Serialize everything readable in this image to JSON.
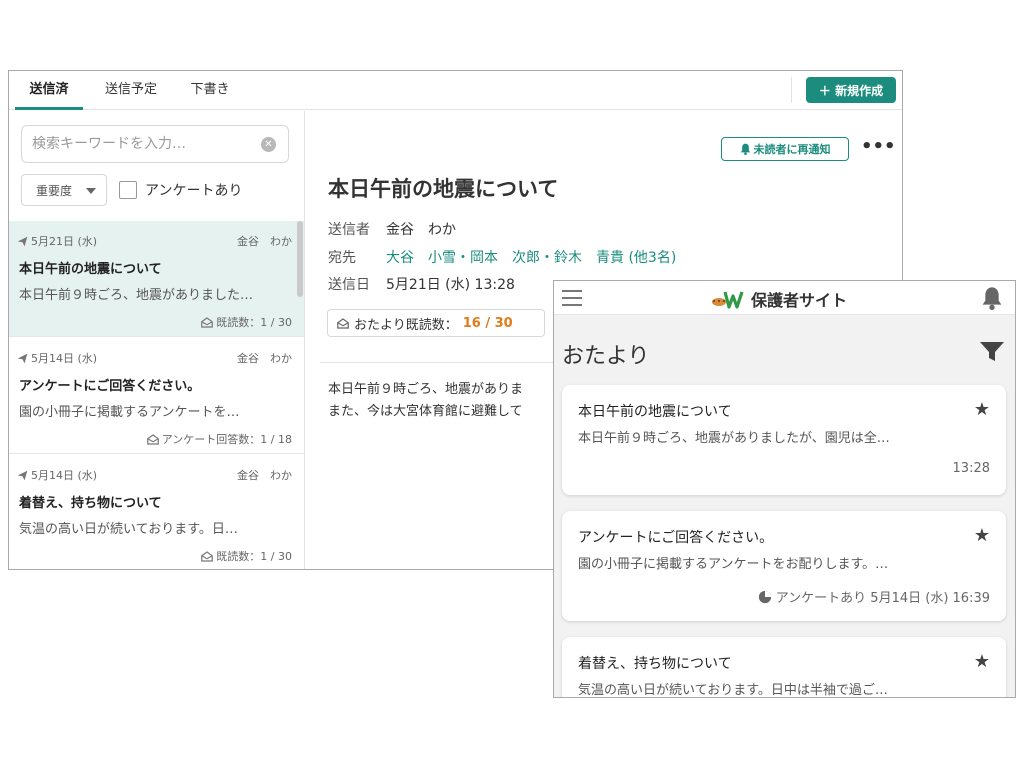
{
  "admin": {
    "tabs": [
      {
        "label": "送信済",
        "active": true
      },
      {
        "label": "送信予定",
        "active": false
      },
      {
        "label": "下書き",
        "active": false
      }
    ],
    "new_button": "＋ 新規作成",
    "search_placeholder": "検索キーワードを入力…",
    "priority_label": "重要度",
    "survey_filter_label": "アンケートあり",
    "messages": [
      {
        "date": "5月21日 (水)",
        "sender": "金谷　わか",
        "title": "本日午前の地震について",
        "preview": "本日午前９時ごろ、地震がありました…",
        "stat_icon": "open-envelope-icon",
        "stat": "既読数：1 / 30",
        "selected": true
      },
      {
        "date": "5月14日 (水)",
        "sender": "金谷　わか",
        "title": "アンケートにご回答ください。",
        "preview": "園の小冊子に掲載するアンケートを…",
        "stat_icon": "open-envelope-icon",
        "stat": "アンケート回答数：1 / 18",
        "selected": false
      },
      {
        "date": "5月14日 (水)",
        "sender": "金谷　わか",
        "title": "着替え、持ち物について",
        "preview": "気温の高い日が続いております。日…",
        "stat_icon": "open-envelope-icon",
        "stat": "既読数：1 / 30",
        "selected": false
      }
    ],
    "detail": {
      "renotify_label": "未読者に再通知",
      "more_label": "•••",
      "title": "本日午前の地震について",
      "from_label": "送信者",
      "from_value": "金谷　わか",
      "to_label": "宛先",
      "recipients": [
        "大谷",
        "小雪・岡本",
        "次郎・鈴木",
        "青貴 (他3名)"
      ],
      "date_label": "送信日",
      "date_value": "5月21日 (水) 13:28",
      "read_label": "おたより既読数：",
      "read_value": "16 / 30",
      "body_lines": [
        "本日午前９時ごろ、地震がありま",
        "また、今は大宮体育館に避難して"
      ]
    }
  },
  "mobile": {
    "site_title": "保護者サイト",
    "page_title": "おたより",
    "cards": [
      {
        "title": "本日午前の地震について",
        "preview": "本日午前９時ごろ、地震がありましたが、園児は全…",
        "meta_icon": "",
        "meta": "13:28"
      },
      {
        "title": "アンケートにご回答ください。",
        "preview": "園の小冊子に掲載するアンケートをお配りします。…",
        "meta_icon": "pie-chart-icon",
        "meta": "アンケートあり 5月14日 (水) 16:39"
      },
      {
        "title": "着替え、持ち物について",
        "preview": "気温の高い日が続いております。日中は半袖で過ご…",
        "meta_icon": "",
        "meta": ""
      }
    ]
  },
  "colors": {
    "accent": "#1b8c7d",
    "selected_row": "#e6f2ef",
    "read_count": "#e07b1a"
  }
}
